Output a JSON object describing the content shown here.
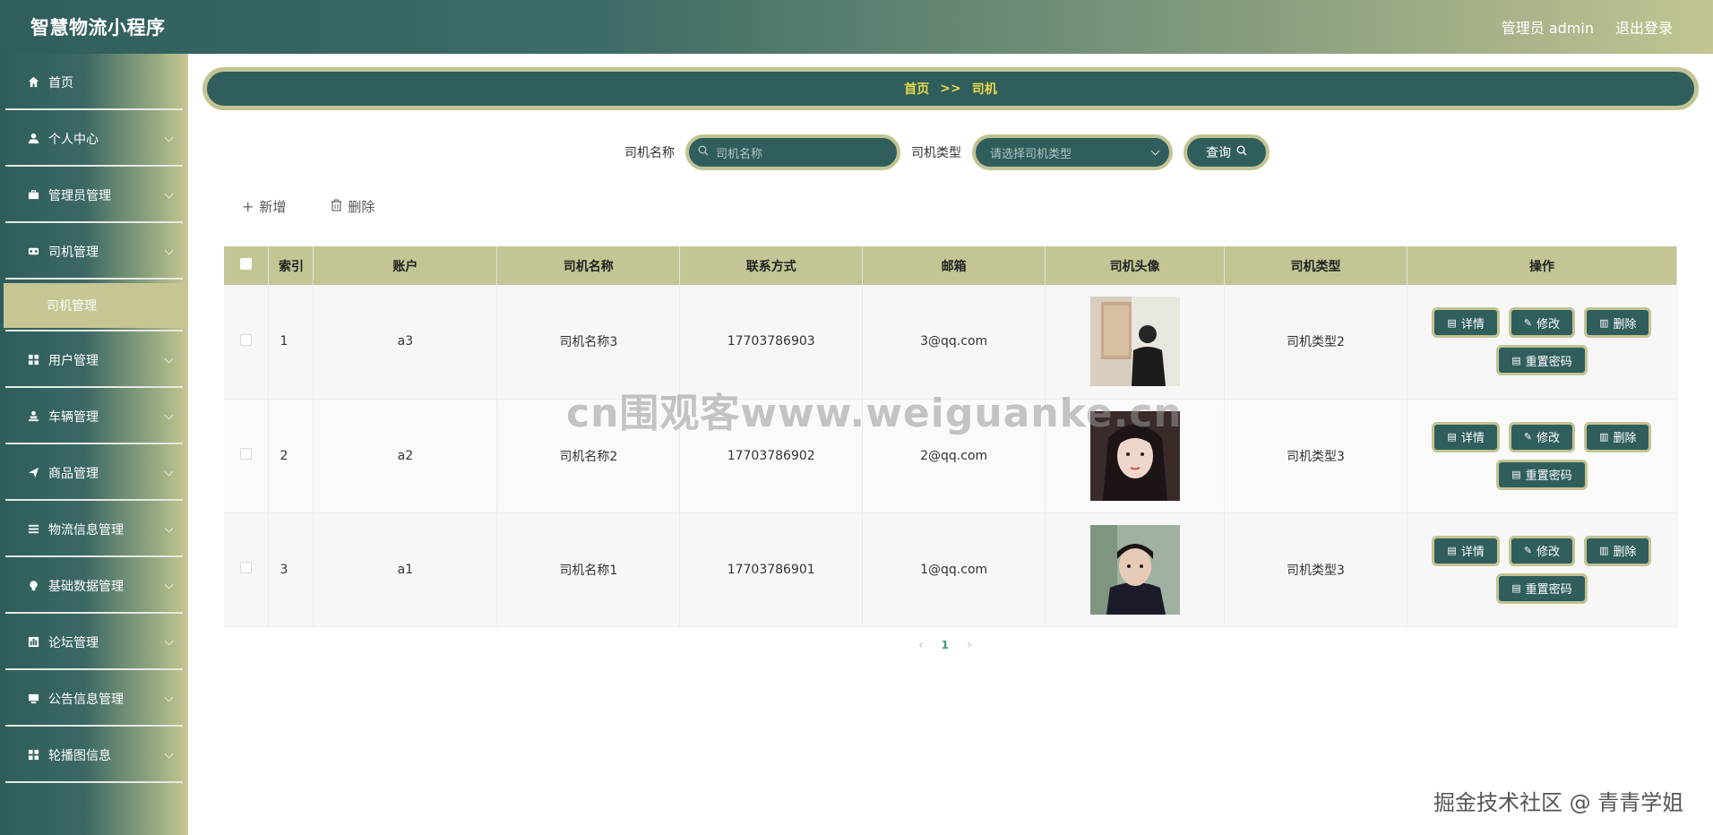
{
  "header": {
    "app_title": "智慧物流小程序",
    "user_label": "管理员 admin",
    "logout_label": "退出登录"
  },
  "sidebar": {
    "items": [
      {
        "label": "首页",
        "icon": "home-icon",
        "expandable": false
      },
      {
        "label": "个人中心",
        "icon": "user-icon",
        "expandable": true
      },
      {
        "label": "管理员管理",
        "icon": "briefcase-icon",
        "expandable": true
      },
      {
        "label": "司机管理",
        "icon": "driver-icon",
        "expandable": true
      },
      {
        "label": "用户管理",
        "icon": "grid-icon",
        "expandable": true
      },
      {
        "label": "车辆管理",
        "icon": "person-icon",
        "expandable": true
      },
      {
        "label": "商品管理",
        "icon": "send-icon",
        "expandable": true
      },
      {
        "label": "物流信息管理",
        "icon": "list-icon",
        "expandable": true
      },
      {
        "label": "基础数据管理",
        "icon": "bulb-icon",
        "expandable": true
      },
      {
        "label": "论坛管理",
        "icon": "chart-icon",
        "expandable": true
      },
      {
        "label": "公告信息管理",
        "icon": "monitor-icon",
        "expandable": true
      },
      {
        "label": "轮播图信息",
        "icon": "grid-icon",
        "expandable": true
      }
    ],
    "active_submenu": "司机管理"
  },
  "breadcrumb": {
    "home": "首页",
    "separator": ">>",
    "current": "司机"
  },
  "search": {
    "name_label": "司机名称",
    "name_placeholder": "司机名称",
    "type_label": "司机类型",
    "type_placeholder": "请选择司机类型",
    "query_label": "查询"
  },
  "actions": {
    "add_label": "新增",
    "delete_label": "删除"
  },
  "table": {
    "headers": [
      "索引",
      "账户",
      "司机名称",
      "联系方式",
      "邮箱",
      "司机头像",
      "司机类型",
      "操作"
    ],
    "rows": [
      {
        "index": "1",
        "account": "a3",
        "name": "司机名称3",
        "phone": "17703786903",
        "email": "3@qq.com",
        "type": "司机类型2"
      },
      {
        "index": "2",
        "account": "a2",
        "name": "司机名称2",
        "phone": "17703786902",
        "email": "2@qq.com",
        "type": "司机类型3"
      },
      {
        "index": "3",
        "account": "a1",
        "name": "司机名称1",
        "phone": "17703786901",
        "email": "1@qq.com",
        "type": "司机类型3"
      }
    ],
    "op_labels": {
      "detail": "详情",
      "edit": "修改",
      "delete": "删除",
      "reset": "重置密码"
    }
  },
  "pagination": {
    "current_page": "1"
  },
  "watermarks": {
    "center": "cn围观客www.weiguanke.cn",
    "corner": "掘金技术社区 @ 青青学姐"
  },
  "colors": {
    "primary": "#2f5e5c",
    "accent": "#c3c393",
    "breadcrumb_text": "#e9d84a"
  }
}
